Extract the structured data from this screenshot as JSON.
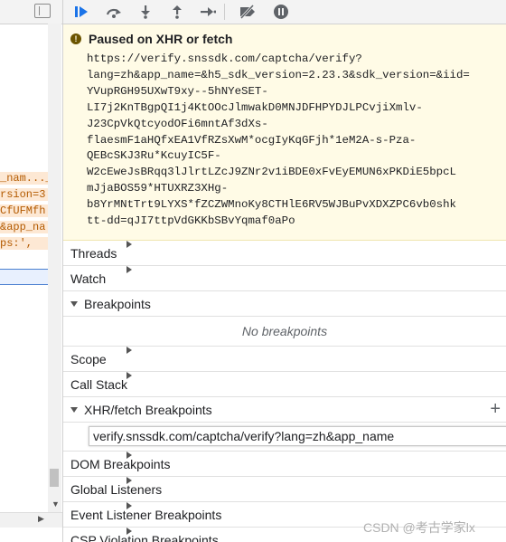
{
  "left_pane": {
    "code_lines": [
      "_nam..._v",
      "rsion=3",
      "CfUFMfh",
      "&app_na",
      "ps:',"
    ]
  },
  "toolbar": {
    "buttons": [
      {
        "name": "resume-icon",
        "glyph": "▶"
      },
      {
        "name": "step-over-icon",
        "glyph": "↷"
      },
      {
        "name": "step-into-icon",
        "glyph": "↓"
      },
      {
        "name": "step-out-icon",
        "glyph": "↑"
      },
      {
        "name": "step-icon",
        "glyph": "→"
      },
      {
        "name": "deactivate-breakpoints-icon",
        "glyph": "⧸"
      },
      {
        "name": "pause-on-exceptions-icon",
        "glyph": "⏸"
      }
    ]
  },
  "paused": {
    "title": "Paused on XHR or fetch",
    "url": "https://verify.snssdk.com/captcha/verify?\nlang=zh&app_name=&h5_sdk_version=2.23.3&sdk_version=&iid=\nYVupRGH95UXwT9xy--5hNYeSET-\nLI7j2KnTBgpQI1j4KtOOcJlmwakD0MNJDFHPYDJLPCvjiXmlv-\nJ23CpVkQtcyodOFi6mntAf3dXs-\nflaesmF1aHQfxEA1VfRZsXwM*ocgIyKqGFjh*1eM2A-s-Pza-\nQEBcSKJ3Ru*KcuyIC5F-\nW2cEweJsBRqq3lJlrtLZcJ9ZNr2v1iBDE0xFvEyEMUN6xPKDiE5bpcL\nmJjaBOS59*HTUXRZ3XHg-\nb8YrMNtTrt9LYXS*fZCZWMnoKy8CTHlE6RV5WJBuPvXDXZPC6vb0shk\ntt-dd=qJI7ttpVdGKKbSBvYqmaf0aPo"
  },
  "sections": {
    "threads": "Threads",
    "watch": "Watch",
    "breakpoints": "Breakpoints",
    "no_breakpoints": "No breakpoints",
    "scope": "Scope",
    "call_stack": "Call Stack",
    "xhr_breakpoints": "XHR/fetch Breakpoints",
    "xhr_value": "verify.snssdk.com/captcha/verify?lang=zh&app_name",
    "dom_breakpoints": "DOM Breakpoints",
    "global_listeners": "Global Listeners",
    "event_listener_breakpoints": "Event Listener Breakpoints",
    "csp_violation_breakpoints": "CSP Violation Breakpoints"
  },
  "watermark": "CSDN @考古学家lx"
}
